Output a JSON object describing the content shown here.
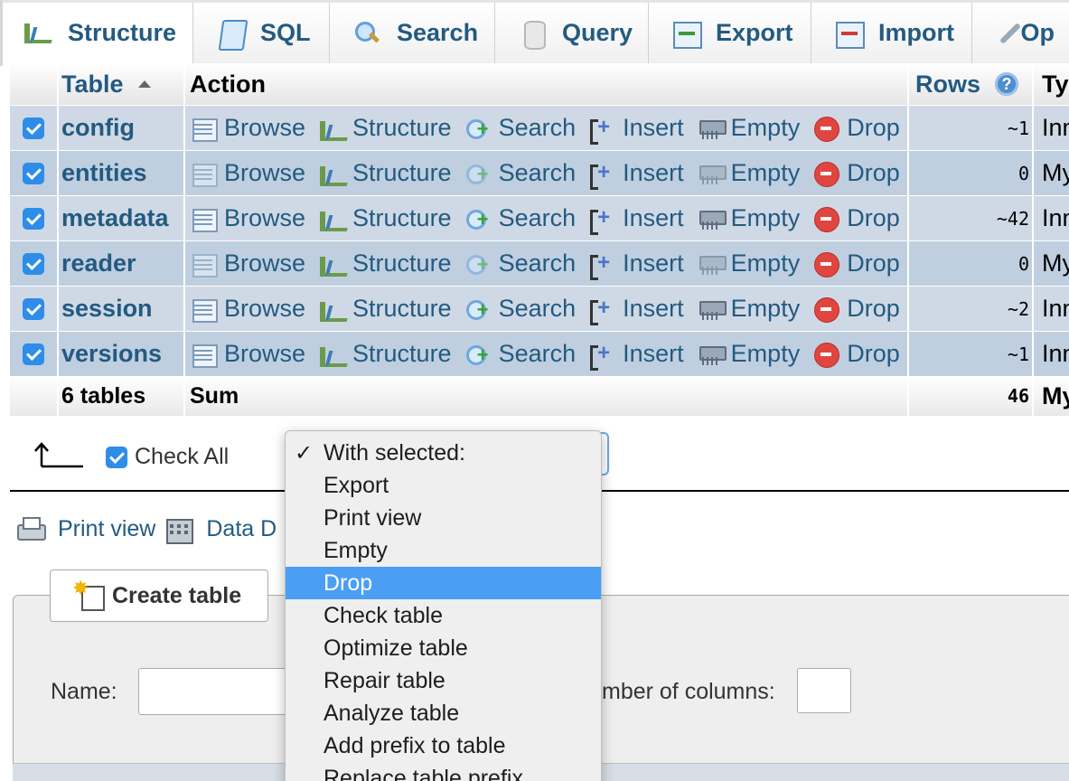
{
  "tabs": [
    {
      "label": "Structure",
      "icon": "structure-icon",
      "active": true
    },
    {
      "label": "SQL",
      "icon": "sql-icon"
    },
    {
      "label": "Search",
      "icon": "search-icon"
    },
    {
      "label": "Query",
      "icon": "query-icon"
    },
    {
      "label": "Export",
      "icon": "export-icon"
    },
    {
      "label": "Import",
      "icon": "import-icon"
    },
    {
      "label": "Op",
      "icon": "wrench-icon"
    }
  ],
  "table": {
    "headers": {
      "table": "Table",
      "action": "Action",
      "rows": "Rows",
      "type": "Ty"
    },
    "actions": {
      "browse": "Browse",
      "structure": "Structure",
      "search": "Search",
      "insert": "Insert",
      "empty": "Empty",
      "drop": "Drop"
    },
    "rows": [
      {
        "name": "config",
        "rows": "~1",
        "type": "Inn"
      },
      {
        "name": "entities",
        "rows": "0",
        "type": "My"
      },
      {
        "name": "metadata",
        "rows": "~42",
        "type": "Inn"
      },
      {
        "name": "reader",
        "rows": "0",
        "type": "My"
      },
      {
        "name": "session",
        "rows": "~2",
        "type": "Inn"
      },
      {
        "name": "versions",
        "rows": "~1",
        "type": "Inn"
      }
    ],
    "footer": {
      "count": "6 tables",
      "label": "Sum",
      "rows": "46",
      "type": "My"
    }
  },
  "bulk": {
    "check_all": "Check All"
  },
  "menu": {
    "items": [
      {
        "label": "With selected:",
        "checked": true
      },
      {
        "label": "Export"
      },
      {
        "label": "Print view"
      },
      {
        "label": "Empty"
      },
      {
        "label": "Drop",
        "highlighted": true
      },
      {
        "label": "Check table"
      },
      {
        "label": "Optimize table"
      },
      {
        "label": "Repair table"
      },
      {
        "label": "Analyze table"
      },
      {
        "label": "Add prefix to table"
      },
      {
        "label": "Replace table prefix"
      }
    ]
  },
  "links": {
    "print_view": "Print view",
    "data_dictionary": "Data D"
  },
  "create": {
    "button": "Create table",
    "name_label": "Name:",
    "name_value": "",
    "columns_label": "mber of columns:",
    "columns_value": ""
  },
  "colors": {
    "link": "#235a81",
    "row": "#cfd9e5",
    "row_alt": "#bfcfe0",
    "menu_highlight": "#4a9ff5",
    "checkbox": "#2d8de8"
  }
}
